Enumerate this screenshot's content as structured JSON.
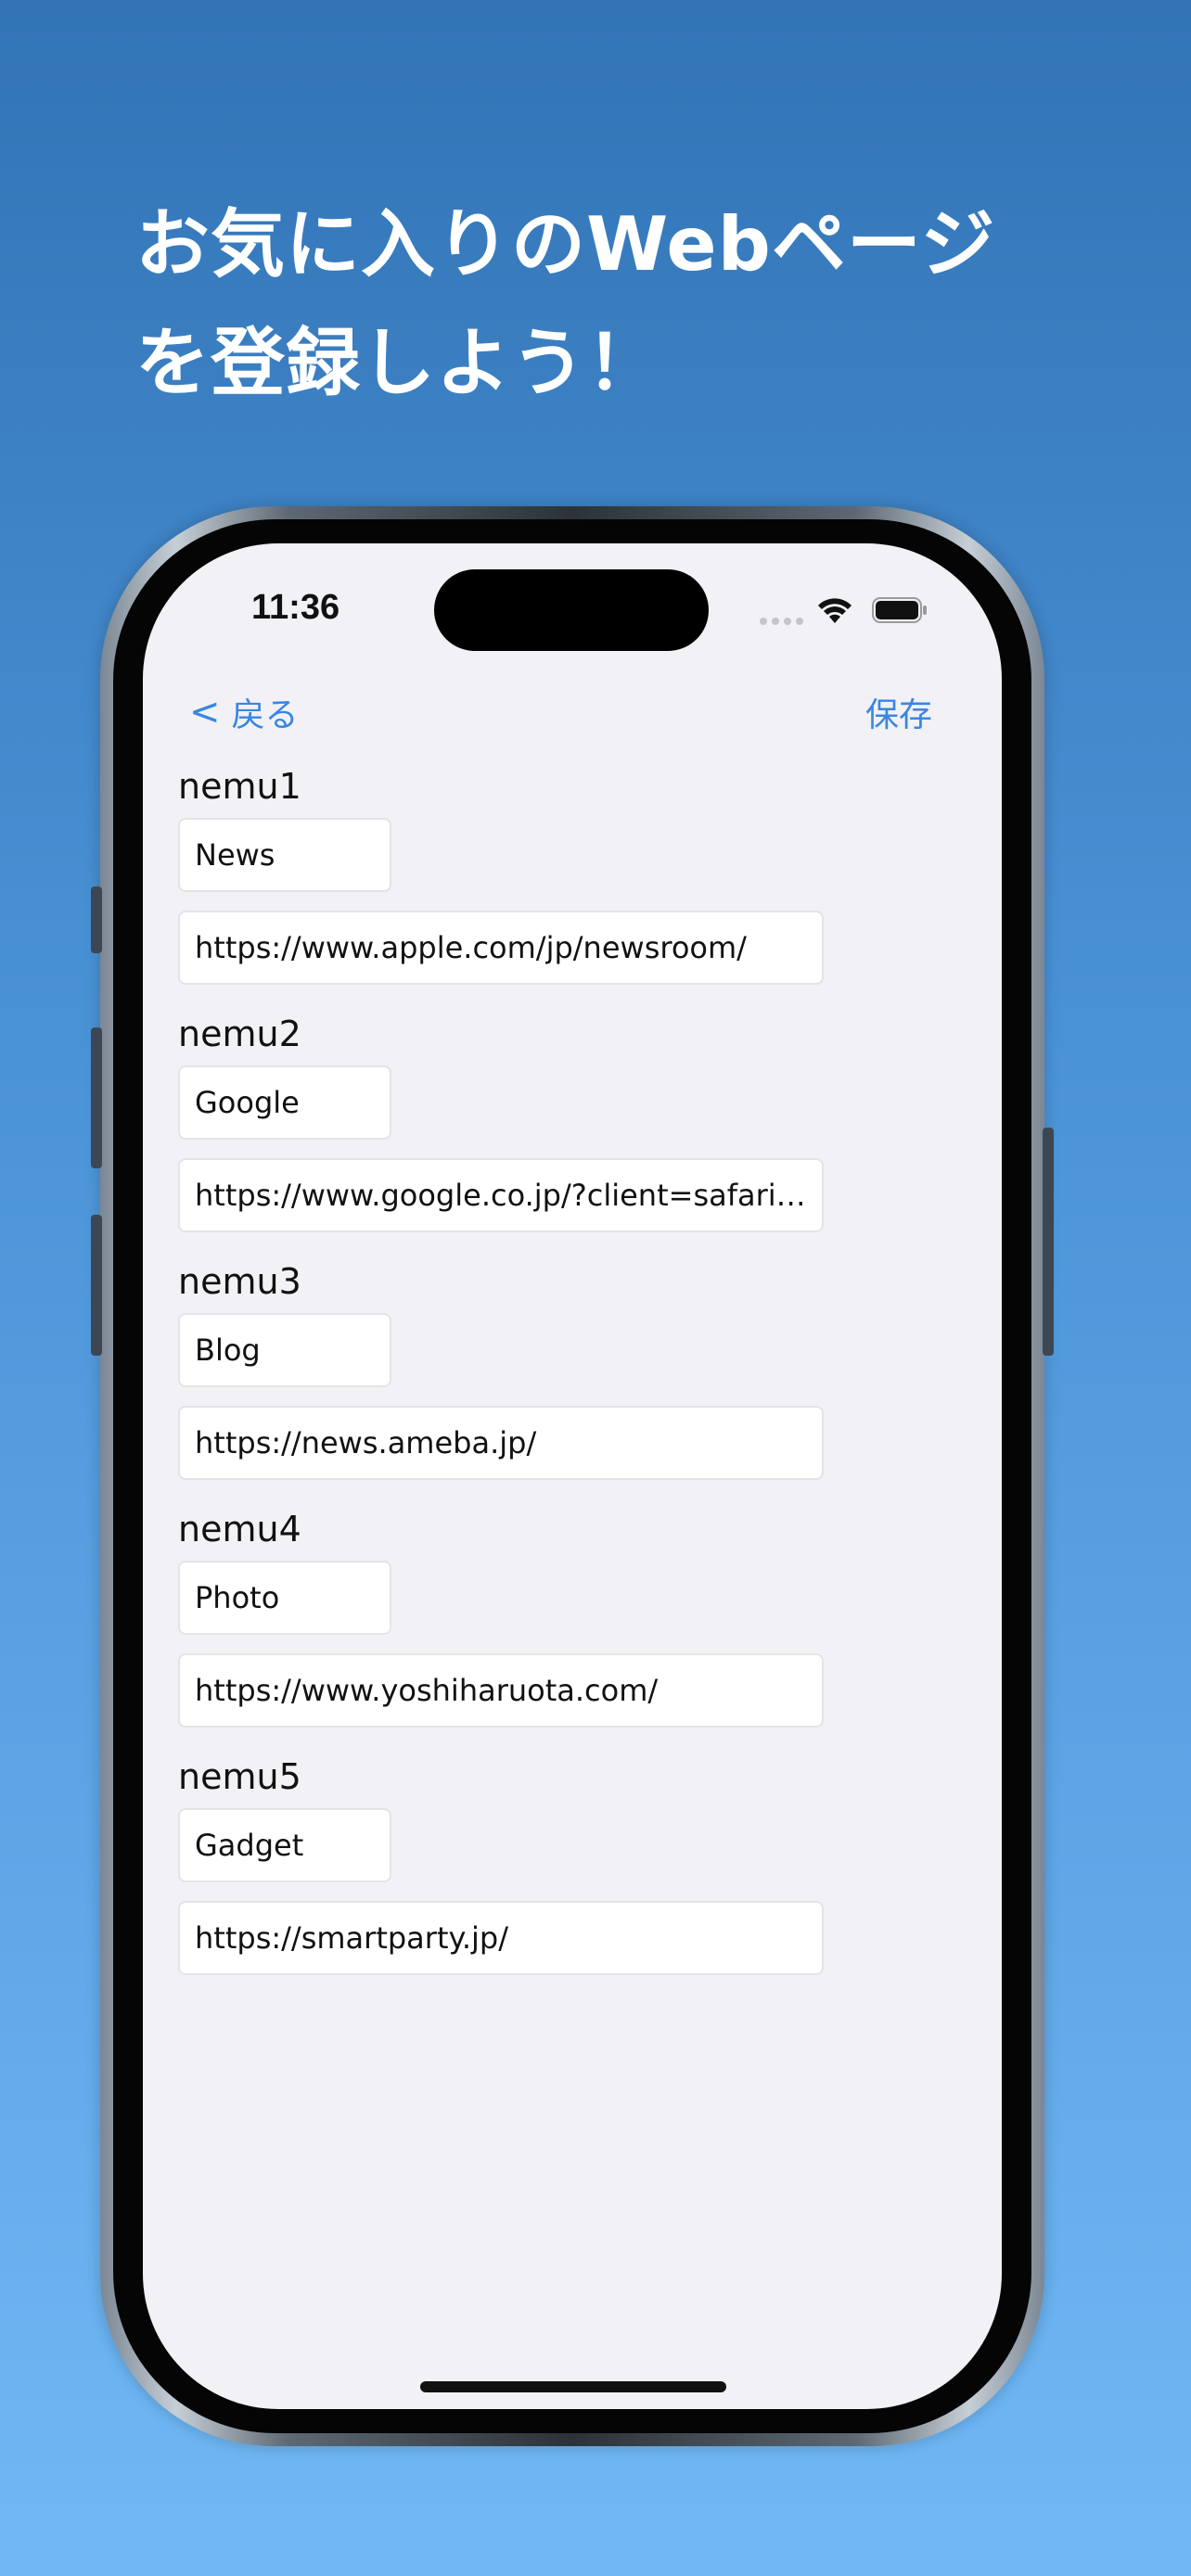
{
  "headline": {
    "line1": "お気に入りのWebページ",
    "line2": "を登録しよう！"
  },
  "status_bar": {
    "time": "11:36",
    "icons": [
      "wifi-icon",
      "battery-icon"
    ]
  },
  "nav": {
    "back_label": "戻る",
    "back_icon": "chevron-left-icon",
    "save_label": "保存"
  },
  "entries": [
    {
      "label": "nemu1",
      "name": "News",
      "url": "https://www.apple.com/jp/newsroom/"
    },
    {
      "label": "nemu2",
      "name": "Google",
      "url": "https://www.google.co.jp/?client=safari&c..."
    },
    {
      "label": "nemu3",
      "name": "Blog",
      "url": "https://news.ameba.jp/"
    },
    {
      "label": "nemu4",
      "name": "Photo",
      "url": "https://www.yoshiharuota.com/"
    },
    {
      "label": "nemu5",
      "name": "Gadget",
      "url": "https://smartparty.jp/"
    }
  ],
  "colors": {
    "accent": "#3a86e0",
    "screen_background": "#f1f1f6",
    "background_top": "#3274b6",
    "background_bottom": "#70b8f5"
  }
}
